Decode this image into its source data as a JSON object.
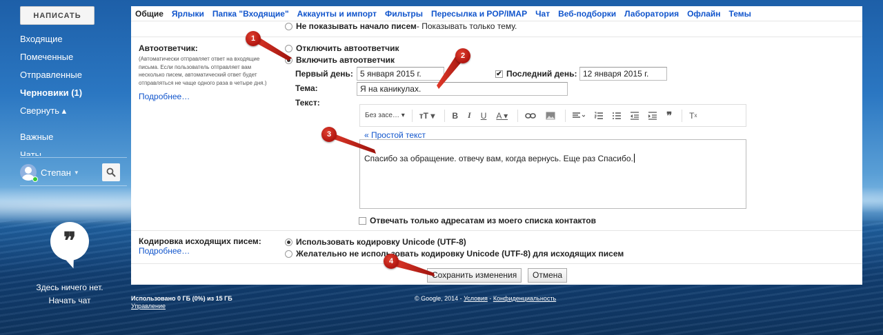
{
  "sidebar": {
    "compose_label": "НАПИСАТЬ",
    "items": [
      {
        "label": "Входящие",
        "bold": false
      },
      {
        "label": "Помеченные",
        "bold": false
      },
      {
        "label": "Отправленные",
        "bold": false
      },
      {
        "label": "Черновики (1)",
        "bold": true
      },
      {
        "label": "Свернуть ▴",
        "bold": false
      }
    ],
    "items2": [
      {
        "label": "Важные"
      },
      {
        "label": "Чаты"
      }
    ],
    "user_name": "Степан",
    "chat_empty_line1": "Здесь ничего нет.",
    "chat_empty_line2": "Начать чат"
  },
  "tabs": [
    {
      "label": "Общие",
      "active": true
    },
    {
      "label": "Ярлыки"
    },
    {
      "label": "Папка \"Входящие\""
    },
    {
      "label": "Аккаунты и импорт"
    },
    {
      "label": "Фильтры"
    },
    {
      "label": "Пересылка и POP/IMAP"
    },
    {
      "label": "Чат"
    },
    {
      "label": "Веб-подборки"
    },
    {
      "label": "Лаборатория"
    },
    {
      "label": "Офлайн"
    },
    {
      "label": "Темы"
    }
  ],
  "snippets": {
    "option_bold": "Не показывать начало писем",
    "option_rest": " - Показывать только тему."
  },
  "autoresponder": {
    "label": "Автоответчик:",
    "description": "(Автоматически отправляет ответ на входящие письма. Если пользователь отправляет вам несколько писем, автоматический ответ будет отправляться не чаще одного раза в четыре дня.)",
    "more_link": "Подробнее…",
    "off_label": "Отключить автоответчик",
    "on_label": "Включить автоответчик",
    "selected": "on",
    "first_day_label": "Первый день:",
    "first_day_value": "5 января 2015 г.",
    "last_day_checked": true,
    "last_day_label": "Последний день:",
    "last_day_value": "12 января 2015 г.",
    "subject_label": "Тема:",
    "subject_value": "Я на каникулах.",
    "text_label": "Текст:",
    "font_select": "Без засе…",
    "plain_text_link": "« Простой текст",
    "body_text": "Спасибо за обращение.  отвечу вам, когда вернусь. Еще раз Спасибо.",
    "contacts_only_checked": false,
    "contacts_only_label": "Отвечать только адресатам из моего списка контактов"
  },
  "encoding": {
    "label": "Кодировка исходящих писем:",
    "more_link": "Подробнее…",
    "option1": "Использовать кодировку Unicode (UTF-8)",
    "option2": "Желательно не использовать кодировку Unicode (UTF-8) для исходящих писем",
    "selected": "option1"
  },
  "buttons": {
    "save": "Сохранить изменения",
    "cancel": "Отмена"
  },
  "footer": {
    "usage": "Использовано 0 ГБ (0%) из 15 ГБ",
    "manage": "Управление",
    "copyright": "© Google, 2014 - ",
    "terms": "Условия",
    "sep": " - ",
    "privacy": "Конфиденциальность"
  },
  "markers": [
    "1",
    "2",
    "3",
    "4"
  ],
  "colors": {
    "link": "#1155cc",
    "marker": "#c8201a"
  }
}
